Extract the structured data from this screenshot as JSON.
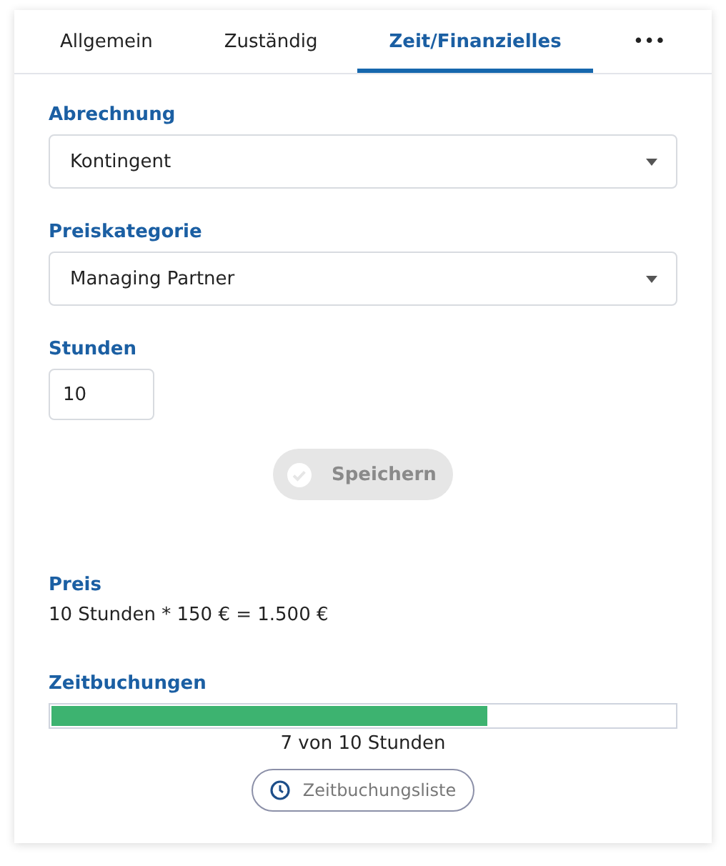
{
  "tabs": [
    {
      "label": "Allgemein",
      "selected": false
    },
    {
      "label": "Zuständig",
      "selected": false
    },
    {
      "label": "Zeit/Finanzielles",
      "selected": true
    },
    {
      "label": "•••",
      "selected": false
    }
  ],
  "billing": {
    "label": "Abrechnung",
    "value": "Kontingent"
  },
  "price_category": {
    "label": "Preiskategorie",
    "value": "Managing Partner"
  },
  "hours": {
    "label": "Stunden",
    "value": "10"
  },
  "save_button": {
    "label": "Speichern",
    "disabled": true
  },
  "price": {
    "label": "Preis",
    "text": "10 Stunden * 150 € = 1.500 €"
  },
  "time_bookings": {
    "label": "Zeitbuchungen",
    "level": 0.7,
    "reading": "7 von 10 Stunden",
    "button": "Zeitbuchungsliste"
  }
}
